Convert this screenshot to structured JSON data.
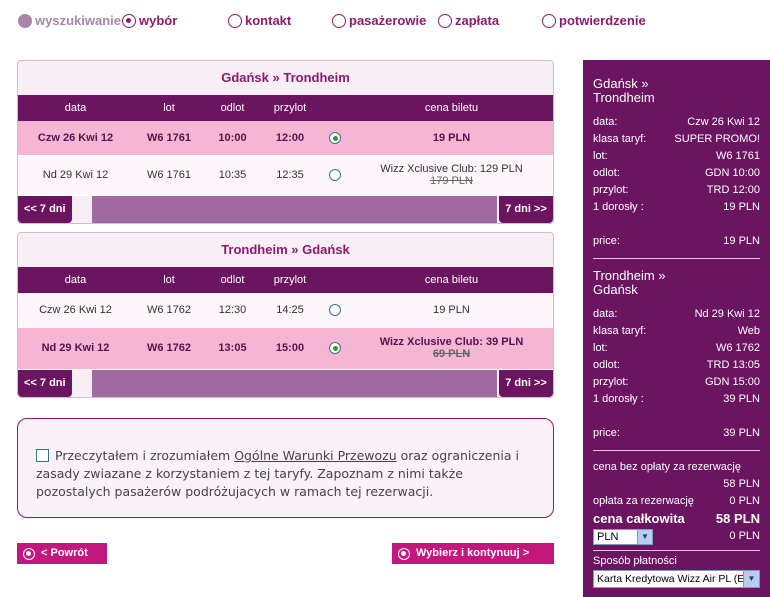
{
  "steps": [
    {
      "label": "wyszukiwanie",
      "state": "done"
    },
    {
      "label": "wybór",
      "state": "active"
    },
    {
      "label": "kontakt",
      "state": "todo"
    },
    {
      "label": "pasażerowie",
      "state": "todo"
    },
    {
      "label": "zapłata",
      "state": "todo"
    },
    {
      "label": "potwierdzenie",
      "state": "todo"
    }
  ],
  "outbound": {
    "title": "Gdańsk » Trondheim",
    "headers": [
      "data",
      "lot",
      "odlot",
      "przylot",
      "",
      "cena biletu"
    ],
    "rows": [
      {
        "date": "Czw 26 Kwi 12",
        "flight": "W6 1761",
        "dep": "10:00",
        "arr": "12:00",
        "price": "19 PLN",
        "old": "",
        "selected": true
      },
      {
        "date": "Nd 29 Kwi 12",
        "flight": "W6 1761",
        "dep": "10:35",
        "arr": "12:35",
        "price": "Wizz Xclusive Club: 129 PLN",
        "old": "179 PLN",
        "selected": false
      }
    ],
    "prev": "<< 7 dni",
    "next": "7 dni >>"
  },
  "return": {
    "title": "Trondheim  » Gdańsk",
    "headers": [
      "data",
      "lot",
      "odlot",
      "przylot",
      "",
      "cena biletu"
    ],
    "rows": [
      {
        "date": "Czw 26 Kwi 12",
        "flight": "W6 1762",
        "dep": "12:30",
        "arr": "14:25",
        "price": "19 PLN",
        "old": "",
        "selected": false
      },
      {
        "date": "Nd 29 Kwi 12",
        "flight": "W6 1762",
        "dep": "13:05",
        "arr": "15:00",
        "price": "Wizz Xclusive Club: 39 PLN",
        "old": "69 PLN",
        "selected": true
      }
    ],
    "prev": "<< 7 dni",
    "next": "7 dni >>"
  },
  "terms": {
    "before": "Przeczytałem i zrozumiałem ",
    "link": "Ogólne Warunki Przewozu",
    "after": " oraz ograniczenia i zasady zwiazane z korzystaniem z tej taryfy. Zapoznam z nimi także pozostalych pasażerów podróżujacych w ramach tej rezerwacji."
  },
  "buttons": {
    "back": "< Powrót",
    "next": "Wybierz i kontynuuj >"
  },
  "summary": {
    "out": {
      "route": "Gdańsk »\nTrondheim",
      "rows": [
        {
          "k": "data:",
          "v": "Czw 26 Kwi 12"
        },
        {
          "k": "klasa taryf:",
          "v": "SUPER PROMO!"
        },
        {
          "k": "lot:",
          "v": "W6 1761"
        },
        {
          "k": "odlot:",
          "v": "GDN 10:00"
        },
        {
          "k": "przylot:",
          "v": "TRD 12:00"
        },
        {
          "k": "1 dorosły :",
          "v": "19 PLN"
        }
      ],
      "price_label": "price:",
      "price": "19 PLN"
    },
    "ret": {
      "route": "Trondheim  »\nGdańsk",
      "rows": [
        {
          "k": "data:",
          "v": "Nd 29 Kwi 12"
        },
        {
          "k": "klasa taryf:",
          "v": "Web"
        },
        {
          "k": "lot:",
          "v": "W6 1762"
        },
        {
          "k": "odlot:",
          "v": "TRD 13:05"
        },
        {
          "k": "przylot:",
          "v": "GDN 15:00"
        },
        {
          "k": "1 dorosły :",
          "v": "39 PLN"
        }
      ],
      "price_label": "price:",
      "price": "39 PLN"
    },
    "no_fee_label": "cena bez opłaty za rezerwację",
    "no_fee_value": "58 PLN",
    "fee_label": "opłata za rezerwację",
    "fee_value": "0 PLN",
    "total_label": "cena całkowita",
    "total_value": "58 PLN",
    "currency": "PLN",
    "currency_total": "0 PLN",
    "payment_label": "Sposób płatności",
    "payment_value": "Karta Kredytowa Wizz Air PL (E"
  },
  "colors": {
    "brand": "#6b1460",
    "accent": "#c4177e",
    "selected_row": "#f4b6d3"
  }
}
